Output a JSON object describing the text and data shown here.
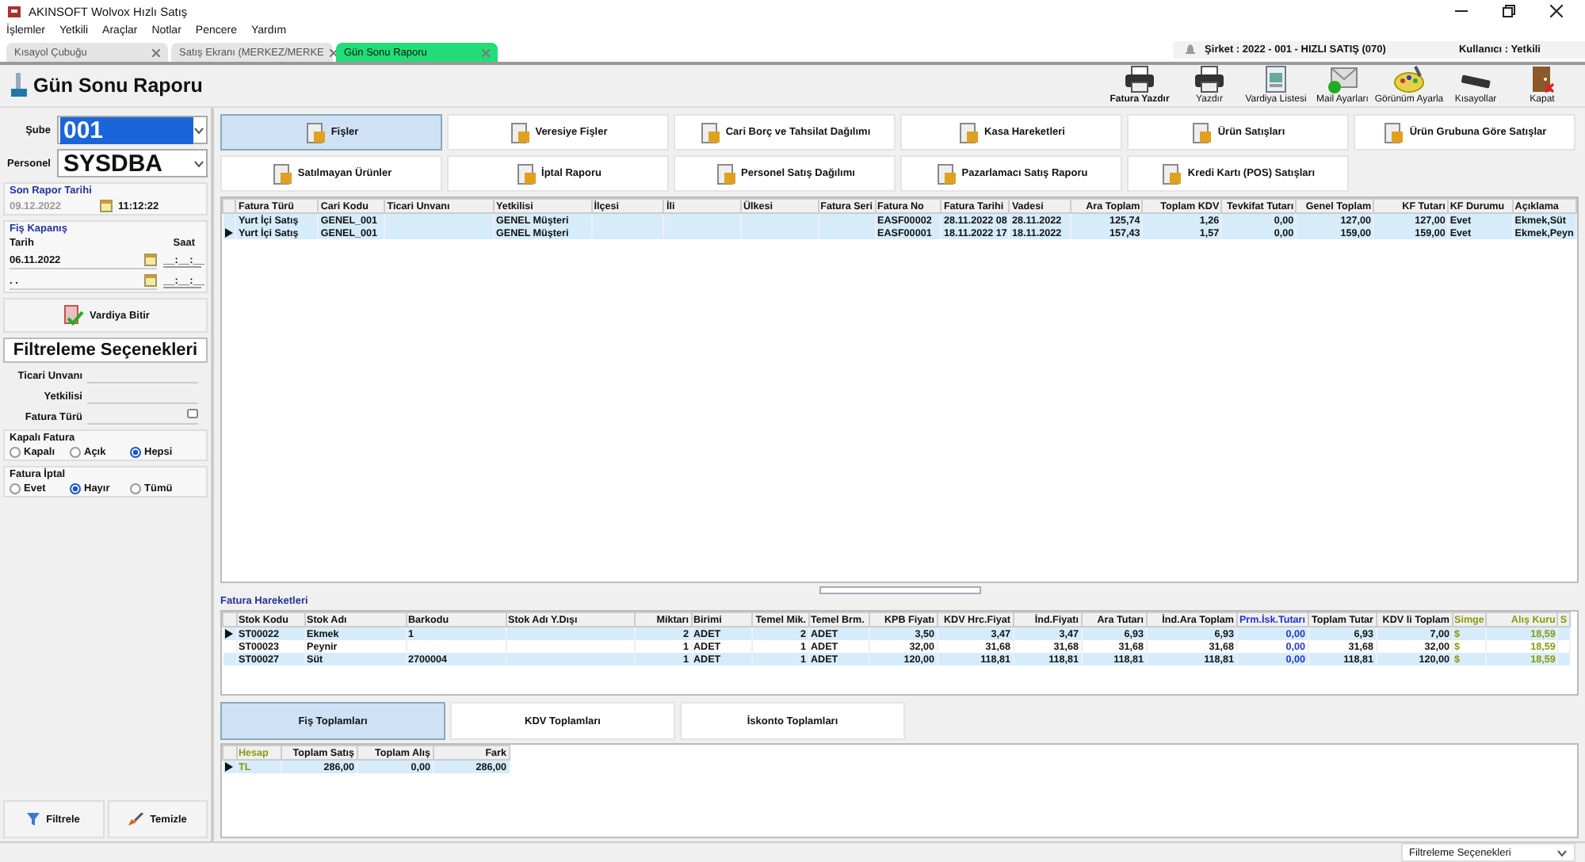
{
  "window": {
    "title": "AKINSOFT Wolvox Hızlı Satış"
  },
  "menu": [
    "İşlemler",
    "Yetkili",
    "Araçlar",
    "Notlar",
    "Pencere",
    "Yardım"
  ],
  "tabs": [
    {
      "label": "Kısayol Çubuğu",
      "selected": false
    },
    {
      "label": "Satış Ekranı (MERKEZ/MERKE",
      "selected": false
    },
    {
      "label": "Gün Sonu Raporu",
      "selected": true
    }
  ],
  "info": {
    "company": "Şirket : 2022 - 001 - HIZLI SATIŞ (070)",
    "user": "Kullanıcı : Yetkili"
  },
  "page_title": "Gün Sonu Raporu",
  "toolbar": [
    {
      "label": "Fatura Yazdır",
      "kind": "printer",
      "emphasized": true
    },
    {
      "label": "Yazdır",
      "kind": "printer",
      "emphasized": false
    },
    {
      "label": "Vardiya Listesi",
      "kind": "list",
      "emphasized": false
    },
    {
      "label": "Mail Ayarları",
      "kind": "mail",
      "emphasized": false
    },
    {
      "label": "Görünüm Ayarla",
      "kind": "palette",
      "emphasized": false
    },
    {
      "label": "Kısayollar",
      "kind": "keyboard",
      "emphasized": false
    },
    {
      "label": "Kapat",
      "kind": "door",
      "emphasized": false
    }
  ],
  "left": {
    "branch": {
      "label": "Şube",
      "value": "001",
      "focused": true
    },
    "staff": {
      "label": "Personel",
      "value": "SYSDBA",
      "focused": false
    },
    "last_report": {
      "title": "Son Rapor Tarihi",
      "date": "09.12.2022",
      "time": "11:12:22"
    },
    "closing": {
      "title": "Fiş Kapanış",
      "date_label": "Tarih",
      "time_label": "Saat",
      "rows": [
        {
          "date": "06.11.2022",
          "time": "__:__:__"
        },
        {
          "date": ". .",
          "time": "__:__:__"
        }
      ]
    },
    "shift_button": "Vardiya Bitir",
    "filter_title": "Filtreleme Seçenekleri",
    "fields": [
      {
        "label": "Ticari Unvanı",
        "kind": "text"
      },
      {
        "label": "Yetkilisi",
        "kind": "text"
      },
      {
        "label": "Fatura Türü",
        "kind": "lookup"
      }
    ],
    "groups": [
      {
        "title": "Kapalı Fatura",
        "options": [
          {
            "label": "Kapalı",
            "selected": false
          },
          {
            "label": "Açık",
            "selected": false
          },
          {
            "label": "Hepsi",
            "selected": true
          }
        ]
      },
      {
        "title": "Fatura İptal",
        "options": [
          {
            "label": "Evet",
            "selected": false
          },
          {
            "label": "Hayır",
            "selected": true
          },
          {
            "label": "Tümü",
            "selected": false
          }
        ]
      }
    ],
    "buttons": [
      {
        "label": "Filtrele",
        "kind": "filter"
      },
      {
        "label": "Temizle",
        "kind": "clear"
      }
    ]
  },
  "report_buttons": [
    {
      "label": "Fişler",
      "selected": true
    },
    {
      "label": "Veresiye Fişler",
      "selected": false
    },
    {
      "label": "Cari Borç ve Tahsilat Dağılımı",
      "selected": false
    },
    {
      "label": "Kasa Hareketleri",
      "selected": false
    },
    {
      "label": "Ürün Satışları",
      "selected": false
    },
    {
      "label": "Ürün Grubuna Göre Satışlar",
      "selected": false
    },
    {
      "label": "Satılmayan Ürünler",
      "selected": false
    },
    {
      "label": "İptal Raporu",
      "selected": false
    },
    {
      "label": "Personel Satış Dağılımı",
      "selected": false
    },
    {
      "label": "Pazarlamacı Satış Raporu",
      "selected": false
    },
    {
      "label": "Kredi Kartı (POS) Satışları",
      "selected": false
    }
  ],
  "invoices": {
    "columns": [
      {
        "label": "Fatura Türü"
      },
      {
        "label": "Cari Kodu"
      },
      {
        "label": "Ticari Unvanı"
      },
      {
        "label": "Yetkilisi"
      },
      {
        "label": "İlçesi"
      },
      {
        "label": "İli"
      },
      {
        "label": "Ülkesi"
      },
      {
        "label": "Fatura Seri"
      },
      {
        "label": "Fatura No"
      },
      {
        "label": "Fatura Tarihi"
      },
      {
        "label": "Vadesi"
      },
      {
        "label": "Ara Toplam",
        "numeric": true
      },
      {
        "label": "Toplam KDV",
        "numeric": true
      },
      {
        "label": "Tevkifat Tutarı",
        "numeric": true
      },
      {
        "label": "Genel Toplam",
        "numeric": true
      },
      {
        "label": "KF Tutarı",
        "numeric": true
      },
      {
        "label": "KF Durumu"
      },
      {
        "label": "Açıklama"
      }
    ],
    "rows": [
      {
        "selected": true,
        "current": false,
        "cells": [
          "Yurt İçi Satış",
          "GENEL_001",
          null,
          "GENEL Müşteri",
          null,
          null,
          null,
          null,
          "EASF00002",
          "28.11.2022 08",
          "28.11.2022",
          "125,74",
          "1,26",
          "0,00",
          "127,00",
          "127,00",
          "Evet",
          "Ekmek,Süt"
        ]
      },
      {
        "selected": true,
        "current": true,
        "cells": [
          "Yurt İçi Satış",
          "GENEL_001",
          null,
          "GENEL Müşteri",
          null,
          null,
          null,
          null,
          "EASF00001",
          "18.11.2022 17",
          "18.11.2022",
          "157,43",
          "1,57",
          "0,00",
          "159,00",
          "159,00",
          "Evet",
          "Ekmek,Peyn"
        ]
      }
    ]
  },
  "invoice_lines": {
    "title": "Fatura Hareketleri",
    "columns": [
      {
        "label": "Stok Kodu"
      },
      {
        "label": "Stok Adı"
      },
      {
        "label": "Barkodu"
      },
      {
        "label": "Stok Adı Y.Dışı"
      },
      {
        "label": "Miktarı",
        "numeric": true
      },
      {
        "label": "Birimi"
      },
      {
        "label": "Temel Mik.",
        "numeric": true
      },
      {
        "label": "Temel Brm."
      },
      {
        "label": "KPB Fiyatı",
        "numeric": true
      },
      {
        "label": "KDV Hrc.Fiyat",
        "numeric": true
      },
      {
        "label": "İnd.Fiyatı",
        "numeric": true
      },
      {
        "label": "Ara Tutarı",
        "numeric": true
      },
      {
        "label": "İnd.Ara Toplam",
        "numeric": true
      },
      {
        "label": "Prm.İsk.Tutarı",
        "numeric": true,
        "color": "#2233cc"
      },
      {
        "label": "Toplam Tutar",
        "numeric": true
      },
      {
        "label": "KDV li Toplam",
        "numeric": true
      },
      {
        "label": "Simge",
        "color": "#8a9a10"
      },
      {
        "label": "Alış Kuru",
        "numeric": true,
        "color": "#8a9a10"
      },
      {
        "label": "S",
        "color": "#8a9a10"
      }
    ],
    "rows": [
      {
        "selected": true,
        "current": true,
        "cells": [
          "ST00022",
          "Ekmek",
          "1",
          null,
          "2",
          "ADET",
          "2",
          "ADET",
          "3,50",
          "3,47",
          "3,47",
          "6,93",
          "6,93",
          "0,00",
          "6,93",
          "7,00",
          "$",
          "18,59",
          null
        ]
      },
      {
        "selected": false,
        "current": false,
        "cells": [
          "ST00023",
          "Peynir",
          null,
          null,
          "1",
          "ADET",
          "1",
          "ADET",
          "32,00",
          "31,68",
          "31,68",
          "31,68",
          "31,68",
          "0,00",
          "31,68",
          "32,00",
          "$",
          "18,59",
          null
        ]
      },
      {
        "selected": true,
        "current": false,
        "cells": [
          "ST00027",
          "Süt",
          "2700004",
          null,
          "1",
          "ADET",
          "1",
          "ADET",
          "120,00",
          "118,81",
          "118,81",
          "118,81",
          "118,81",
          "0,00",
          "118,81",
          "120,00",
          "$",
          "18,59",
          null
        ]
      }
    ]
  },
  "summary_tabs": [
    {
      "label": "Fiş Toplamları",
      "selected": true
    },
    {
      "label": "KDV Toplamları",
      "selected": false
    },
    {
      "label": "İskonto Toplamları",
      "selected": false
    }
  ],
  "totals": {
    "columns": [
      {
        "label": "Hesap",
        "color": "#8a9a10"
      },
      {
        "label": "Toplam Satış",
        "numeric": true
      },
      {
        "label": "Toplam Alış",
        "numeric": true
      },
      {
        "label": "Fark",
        "numeric": true
      }
    ],
    "rows": [
      {
        "selected": true,
        "current": true,
        "cells": [
          "TL",
          "286,00",
          "0,00",
          "286,00"
        ]
      }
    ]
  },
  "status_bar": {
    "filter_label": "Filtreleme Seçenekleri"
  }
}
